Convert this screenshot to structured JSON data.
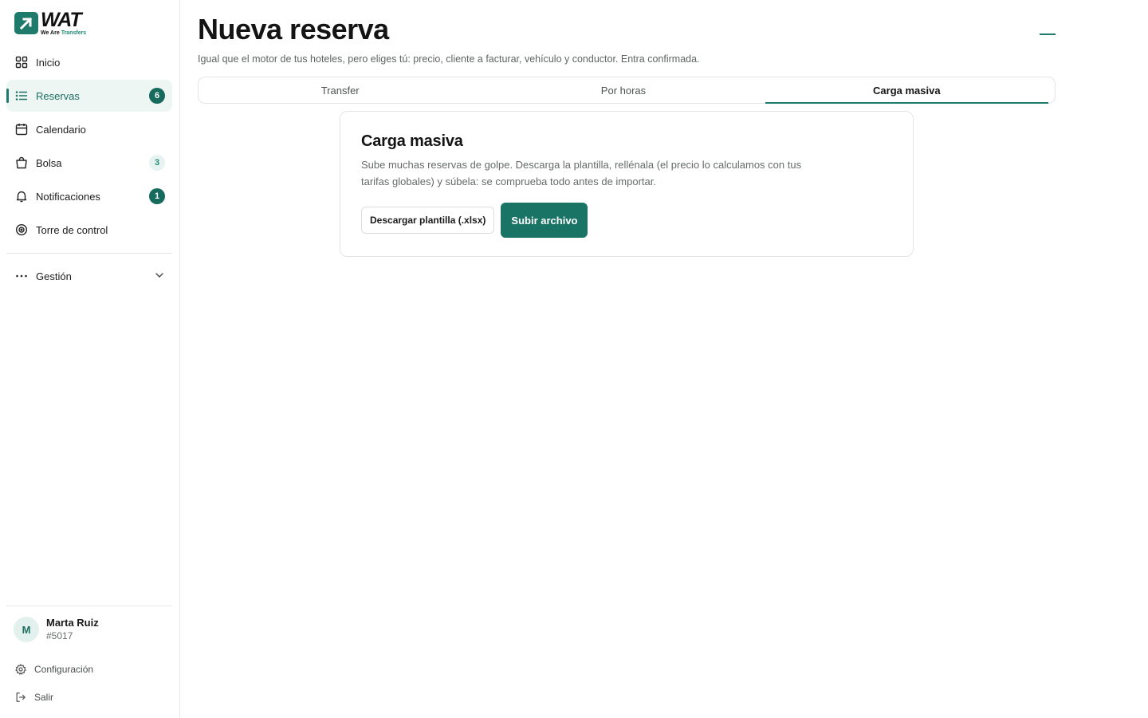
{
  "brand": {
    "name": "WAT",
    "tagline_prefix": "We Are ",
    "tagline_highlight": "Transfers",
    "accent": "#1e7a6a"
  },
  "sidebar": {
    "items": [
      {
        "label": "Inicio",
        "icon": "grid-icon",
        "badge": ""
      },
      {
        "label": "Reservas",
        "icon": "list-icon",
        "badge": "6"
      },
      {
        "label": "Calendario",
        "icon": "calendar-icon",
        "badge": ""
      },
      {
        "label": "Bolsa",
        "icon": "bag-icon",
        "badge": "3"
      },
      {
        "label": "Notificaciones",
        "icon": "bell-icon",
        "badge": "1"
      },
      {
        "label": "Torre de control",
        "icon": "target-icon",
        "badge": ""
      }
    ],
    "group": {
      "label": "Gestión",
      "icon": "more-icon"
    }
  },
  "user": {
    "initial": "M",
    "name": "Marta Ruiz",
    "id": "#5017",
    "settings_label": "Configuración",
    "logout_label": "Salir"
  },
  "main": {
    "title": "Nueva reserva",
    "subtitle": "Igual que el motor de tus hoteles, pero eliges tú: precio, cliente a facturar, vehículo y conductor. Entra confirmada.",
    "tabs": [
      {
        "label": "Transfer"
      },
      {
        "label": "Por horas"
      },
      {
        "label": "Carga masiva"
      }
    ],
    "active_tab": "Carga masiva"
  },
  "card": {
    "title": "Carga masiva",
    "description": "Sube muchas reservas de golpe. Descarga la plantilla, rellénala (el precio lo calculamos con tus tarifas globales) y súbela: se comprueba todo antes de importar.",
    "download_label": "Descargar plantilla (.xlsx)",
    "upload_label": "Subir archivo"
  }
}
